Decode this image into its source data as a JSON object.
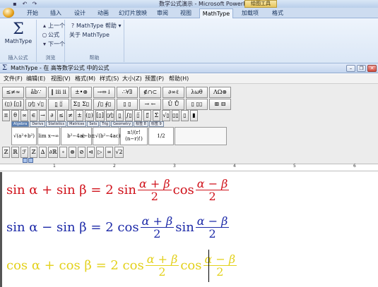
{
  "ppt": {
    "title": "数学公式演示 - Microsoft PowerPoint",
    "context_tab": "绘图工具",
    "quick_access_icons": [
      "save-icon",
      "undo-icon",
      "redo-icon"
    ],
    "tabs": [
      "开始",
      "插入",
      "设计",
      "动画",
      "幻灯片放映",
      "审阅",
      "视图",
      "MathType",
      "加载项",
      "格式"
    ],
    "active_tab": "MathType"
  },
  "ribbon": {
    "groups": {
      "insert": {
        "label": "插入公式",
        "button": "MathType",
        "icon": "sigma-icon"
      },
      "browse": {
        "label": "浏览",
        "prev": "上一个",
        "formula": "公式",
        "next": "下一个"
      },
      "help": {
        "label": "帮助",
        "help_menu": "MathType 帮助",
        "about": "关于 MathType"
      }
    }
  },
  "mathtype": {
    "title": "MathType - 在 高等数学公式 中的公式",
    "menus": [
      "文件(F)",
      "编辑(E)",
      "视图(V)",
      "格式(M)",
      "样式(S)",
      "大小(Z)",
      "预置(P)",
      "帮助(H)"
    ],
    "palette_row1": [
      "≤≠≈",
      "ǎb∵",
      "‖ ⅲ ⅱ",
      "±•⊗",
      "→⇔↓",
      "∴∀∃",
      "∉∩⊂",
      "∂∞ℓ",
      "λωθ",
      "ΛΩ⊗"
    ],
    "palette_row2": [
      "(▯) [▯]",
      "▯⁄▯ √▯",
      "▯̲ ▯̅",
      "Σ▯ Σ▯",
      "∫▯ ∮▯",
      "▯ ▯",
      "→ ←",
      "Ū Ů",
      "▯ ▯▯",
      "⊞ ⊟"
    ],
    "palette_row3": [
      "π",
      "θ",
      "∞",
      "∈",
      "→",
      "∂",
      "≤",
      "≠",
      "±",
      "(▯)",
      "[▯]",
      "▯⁄▯",
      "▯̲",
      "∫▯",
      "▯̅",
      "▯⃗",
      "Σ̇",
      "√▯",
      "▯▯",
      "▯",
      "▮"
    ],
    "template_tabs": [
      "Algebra",
      "Derivs",
      "Statistics",
      "Matrices",
      "Sets",
      "Trig",
      "Geometry",
      "标签 8",
      "标签 9"
    ],
    "active_template_tab": "Algebra",
    "template_cells": [
      "√(a²+b²)",
      "lim x→∞",
      "b²−4ac",
      "(−b±√(b²−4ac))/2a",
      "n!/(r!(n−r)!)",
      "1/2"
    ],
    "palette_row5": [
      "ℤ",
      "ℝ",
      "ℱ",
      "ℤ",
      "∆",
      "∂ℝ",
      "∘",
      "⊗",
      "⊘",
      "⊲",
      "▷",
      "∞",
      "√2"
    ]
  },
  "ruler": {
    "labels": [
      "1",
      "2",
      "3",
      "4",
      "5",
      "6"
    ]
  },
  "equations": [
    {
      "lhs": "sin α + sin β = 2 sin",
      "frac1_num": "α + β",
      "frac1_den": "2",
      "mid": "cos",
      "frac2_num": "α − β",
      "frac2_den": "2",
      "color": "#d0121b"
    },
    {
      "lhs": "sin α − sin β = 2 cos",
      "frac1_num": "α + β",
      "frac1_den": "2",
      "mid": "sin",
      "frac2_num": "α − β",
      "frac2_den": "2",
      "color": "#1d2aa8"
    },
    {
      "lhs": "cos α + cos β = 2 cos",
      "frac1_num": "α + β",
      "frac1_den": "2",
      "mid": "cos",
      "frac2_num": "α − β",
      "frac2_den": "2",
      "color": "#e3d11c"
    }
  ]
}
